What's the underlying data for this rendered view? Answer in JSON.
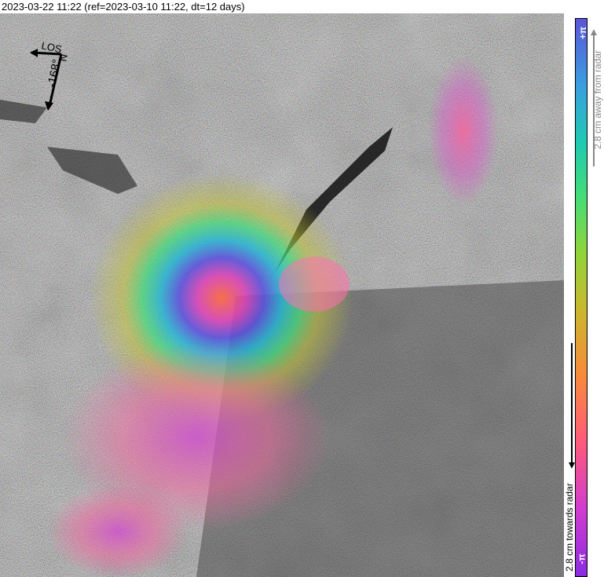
{
  "header": {
    "title": "2023-03-22 11:22 (ref=2023-03-10 11:22, dt=12 days)"
  },
  "image": {
    "description_icon": "interferogram-image",
    "compass": {
      "los_label": "LOS",
      "heading_label": "-168°",
      "north_label": "N"
    }
  },
  "colorbar": {
    "top_label": "+π",
    "bottom_label": "-π",
    "away_text": "2.8 cm away from radar",
    "towards_text": "2.8 cm towards radar",
    "colors": [
      "#8a2be2",
      "#d03ccf",
      "#ff5a7a",
      "#f88a3c",
      "#c9b82d",
      "#8fd43a",
      "#44dd77",
      "#1fc9b3",
      "#3a9fe0",
      "#5a55d8"
    ]
  }
}
